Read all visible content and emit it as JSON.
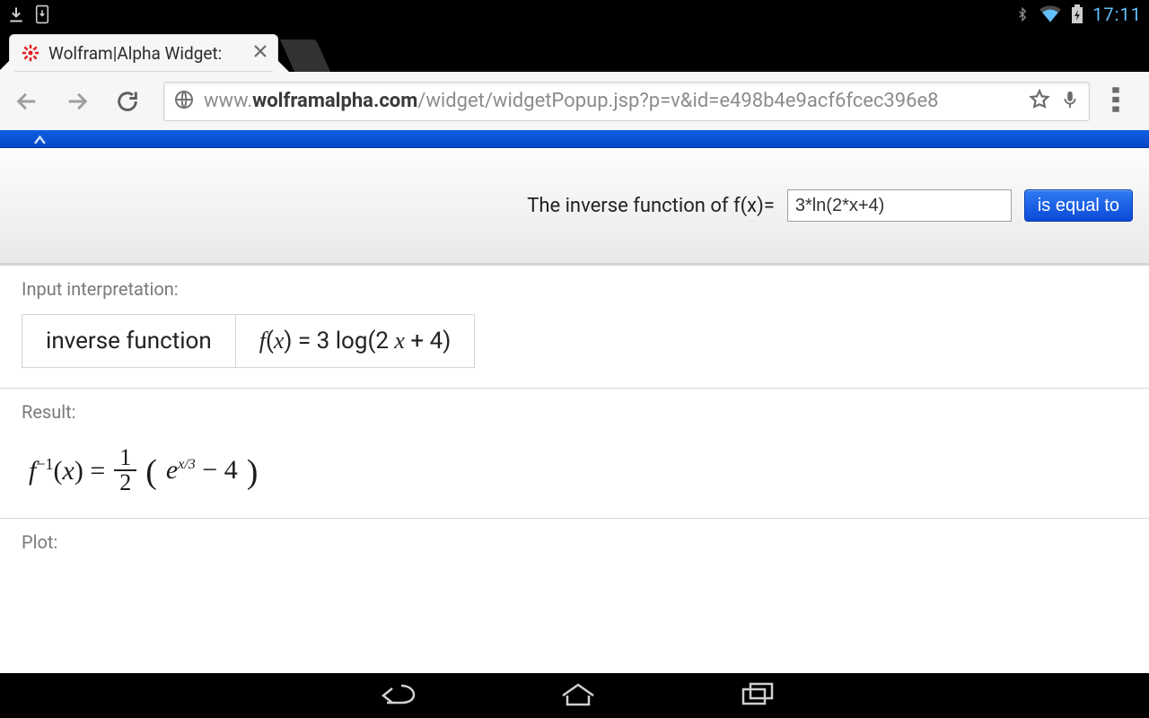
{
  "statusbar": {
    "clock": "17:11"
  },
  "tab": {
    "title": "Wolfram|Alpha Widget:"
  },
  "omnibox": {
    "prefix": "www.",
    "bold": "wolframalpha.com",
    "suffix": "/widget/widgetPopup.jsp?p=v&id=e498b4e9acf6fcec396e8"
  },
  "query": {
    "prompt": "The inverse function of f(x)=",
    "input_value": "3*ln(2*x+4)",
    "button": "is equal to"
  },
  "pods": {
    "interpretation": {
      "label": "Input interpretation:",
      "box1": "inverse function",
      "box2_prefix": "f(x) = 3 log(2 ",
      "box2_var": "x",
      "box2_suffix": " + 4)"
    },
    "result": {
      "label": "Result:",
      "lhs_f": "f",
      "lhs_sup": "−1",
      "lhs_tail": "(x) = ",
      "frac_num": "1",
      "frac_den": "2",
      "e": "e",
      "exp": "x/3",
      "tail": " − 4"
    },
    "plot": {
      "label": "Plot:"
    }
  }
}
